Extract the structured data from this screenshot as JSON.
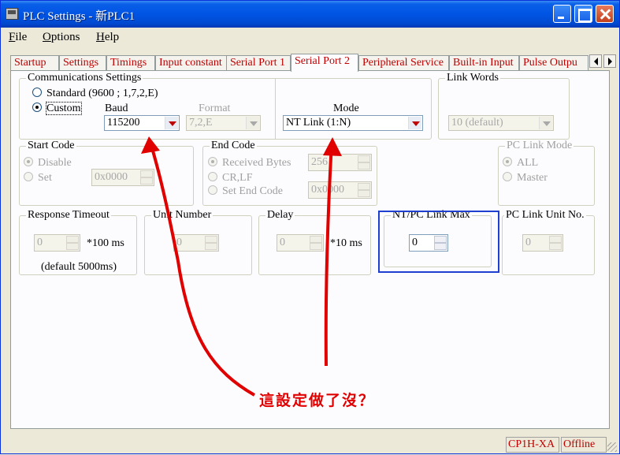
{
  "window": {
    "title": "PLC Settings - 新PLC1"
  },
  "menu": {
    "file": "File",
    "file_key": "F",
    "file_rest": "ile",
    "options_key": "O",
    "options_rest": "ptions",
    "help_key": "H",
    "help_rest": "elp"
  },
  "tabs": [
    {
      "label": "Startup"
    },
    {
      "label": "Settings"
    },
    {
      "label": "Timings"
    },
    {
      "label": "Input constant"
    },
    {
      "label": "Serial Port 1"
    },
    {
      "label": "Serial Port 2",
      "active": true
    },
    {
      "label": "Peripheral Service"
    },
    {
      "label": "Built-in Input"
    },
    {
      "label": "Pulse Outpu"
    }
  ],
  "comm": {
    "legend": "Communications Settings",
    "standard": "Standard (9600 ; 1,7,2,E)",
    "custom": "Custom",
    "baud_label": "Baud",
    "baud_value": "115200",
    "format_label": "Format",
    "format_value": "7,2,E",
    "mode_label": "Mode",
    "mode_value": "NT Link (1:N)"
  },
  "link_words": {
    "legend": "Link Words",
    "value": "10 (default)"
  },
  "start_code": {
    "legend": "Start Code",
    "disable": "Disable",
    "set": "Set",
    "value": "0x0000"
  },
  "end_code": {
    "legend": "End Code",
    "received": "Received Bytes",
    "received_value": "256",
    "crlf": "CR,LF",
    "set_end": "Set End Code",
    "set_end_value": "0x0000"
  },
  "pc_link_mode": {
    "legend": "PC Link Mode",
    "all": "ALL",
    "master": "Master"
  },
  "response_timeout": {
    "legend": "Response Timeout",
    "value": "0",
    "unit": "*100 ms",
    "default": "(default 5000ms)"
  },
  "unit_number": {
    "legend": "Unit Number",
    "value": "0"
  },
  "delay": {
    "legend": "Delay",
    "value": "0",
    "unit": "*10 ms"
  },
  "nt_pc_link_max": {
    "legend": "NT/PC Link Max",
    "value": "0"
  },
  "pc_link_unit_no": {
    "legend": "PC Link Unit No.",
    "value": "0"
  },
  "status": {
    "model": "CP1H-XA",
    "state": "Offline"
  },
  "annotation": {
    "text": "這設定做了沒？",
    "color": "#e00000"
  },
  "colors": {
    "tab_text": "#c00000",
    "highlight": "#1f3fd0",
    "title_bar": "#0054e3"
  }
}
